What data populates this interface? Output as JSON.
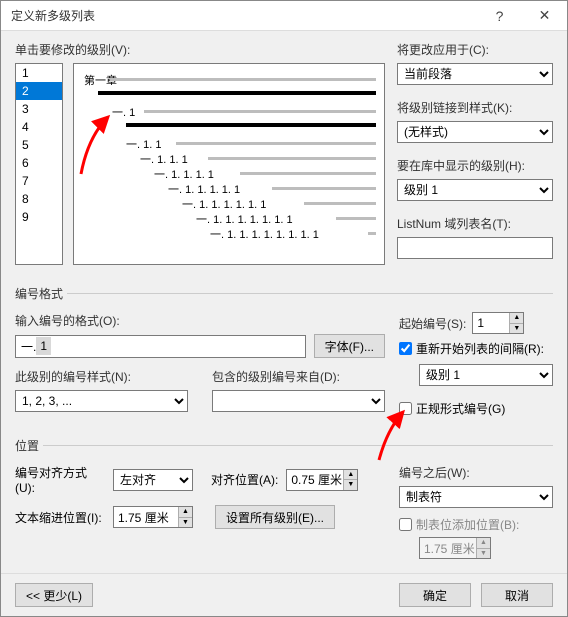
{
  "titlebar": {
    "title": "定义新多级列表"
  },
  "top": {
    "click_level_label": "单击要修改的级别(V):",
    "levels": [
      "1",
      "2",
      "3",
      "4",
      "5",
      "6",
      "7",
      "8",
      "9"
    ],
    "selected_level_index": 1,
    "preview": {
      "lines": [
        {
          "text": "第一章",
          "indent": 0,
          "bold": true
        },
        {
          "text": "一. 1",
          "indent": 28,
          "bold": true
        },
        {
          "text": "一. 1. 1",
          "indent": 42,
          "bold": false
        },
        {
          "text": "一. 1. 1. 1",
          "indent": 56,
          "bold": false
        },
        {
          "text": "一. 1. 1. 1. 1",
          "indent": 70,
          "bold": false
        },
        {
          "text": "一. 1. 1. 1. 1. 1",
          "indent": 84,
          "bold": false
        },
        {
          "text": "一. 1. 1. 1. 1. 1. 1",
          "indent": 98,
          "bold": false
        },
        {
          "text": "一. 1. 1. 1. 1. 1. 1. 1",
          "indent": 112,
          "bold": false
        },
        {
          "text": "一. 1. 1. 1. 1. 1. 1. 1. 1",
          "indent": 126,
          "bold": false
        }
      ]
    }
  },
  "right": {
    "apply_to_label": "将更改应用于(C):",
    "apply_to_value": "当前段落",
    "link_style_label": "将级别链接到样式(K):",
    "link_style_value": "(无样式)",
    "gallery_label": "要在库中显示的级别(H):",
    "gallery_value": "级别 1",
    "listnum_label": "ListNum 域列表名(T):",
    "listnum_value": ""
  },
  "format": {
    "legend": "编号格式",
    "enter_format_label": "输入编号的格式(O):",
    "enter_format_prefix": "一.",
    "enter_format_shaded": "1",
    "font_button": "字体(F)...",
    "style_label": "此级别的编号样式(N):",
    "style_value": "1, 2, 3, ...",
    "include_from_label": "包含的级别编号来自(D):",
    "include_from_value": "",
    "start_at_label": "起始编号(S):",
    "start_at_value": "1",
    "restart_after_label": "重新开始列表的间隔(R):",
    "restart_after_value": "级别 1",
    "restart_after_checked": true,
    "legal_label": "正规形式编号(G)",
    "legal_checked": false
  },
  "position": {
    "legend": "位置",
    "align_label": "编号对齐方式(U):",
    "align_value": "左对齐",
    "align_at_label": "对齐位置(A):",
    "align_at_value": "0.75 厘米",
    "indent_label": "文本缩进位置(I):",
    "indent_value": "1.75 厘米",
    "set_all_button": "设置所有级别(E)...",
    "after_label": "编号之后(W):",
    "after_value": "制表符",
    "add_tab_label": "制表位添加位置(B):",
    "add_tab_checked": false,
    "add_tab_value": "1.75 厘米"
  },
  "footer": {
    "less": "<< 更少(L)",
    "ok": "确定",
    "cancel": "取消"
  }
}
